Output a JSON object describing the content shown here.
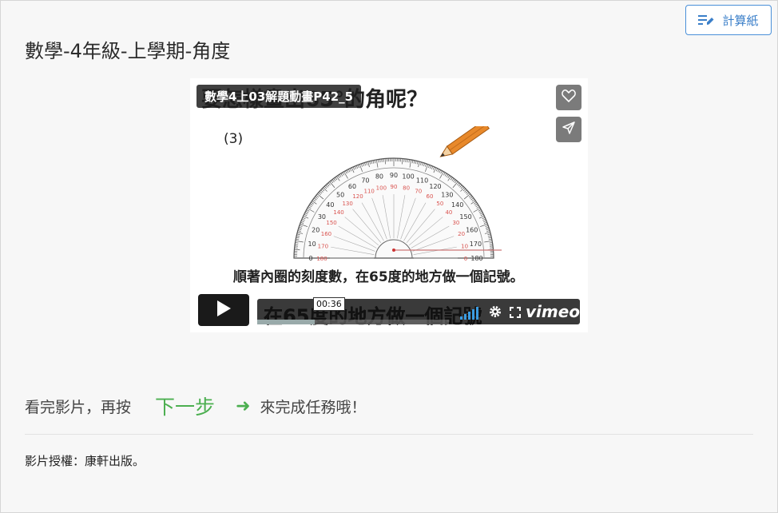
{
  "toolbar": {
    "calc_label": "計算紙",
    "calc_icon": "note-pencil-icon"
  },
  "page": {
    "title": "數學-4年級-上學期-角度"
  },
  "video": {
    "title": "數學4上03解題動畫P42_5",
    "background_heading": "要怎樣畫出65°的角呢？",
    "sub_label": "(3)",
    "instruction": "順著內圈的刻度數，在65度的地方做一個記號。",
    "caption_ghost": "在65度的地方做一個記號",
    "time": "00:36",
    "progress": 0.3,
    "brand": "vimeo",
    "icons": [
      "heart-icon",
      "send-icon",
      "play-icon",
      "volume-icon",
      "gear-icon",
      "fullscreen-icon"
    ],
    "protractor_outer_ticks": [
      "0",
      "10",
      "20",
      "30",
      "40",
      "50",
      "60",
      "70",
      "80",
      "90",
      "100",
      "110",
      "120",
      "130",
      "140",
      "150",
      "160",
      "170",
      "180"
    ],
    "protractor_inner_ticks": [
      "180",
      "170",
      "160",
      "150",
      "140",
      "130",
      "120",
      "110",
      "100",
      "90",
      "80",
      "70",
      "60",
      "50",
      "40",
      "30",
      "20",
      "10",
      "0"
    ]
  },
  "next": {
    "before": "看完影片，再按",
    "link": "下一步",
    "arrow": "➜",
    "after": "來完成任務哦！"
  },
  "credit": "影片授權：康軒出版。",
  "colors": {
    "accent": "#4a90d9",
    "next_green": "#4caf50",
    "volume_blue": "#3b9be0",
    "protractor_red": "#d9534f"
  }
}
